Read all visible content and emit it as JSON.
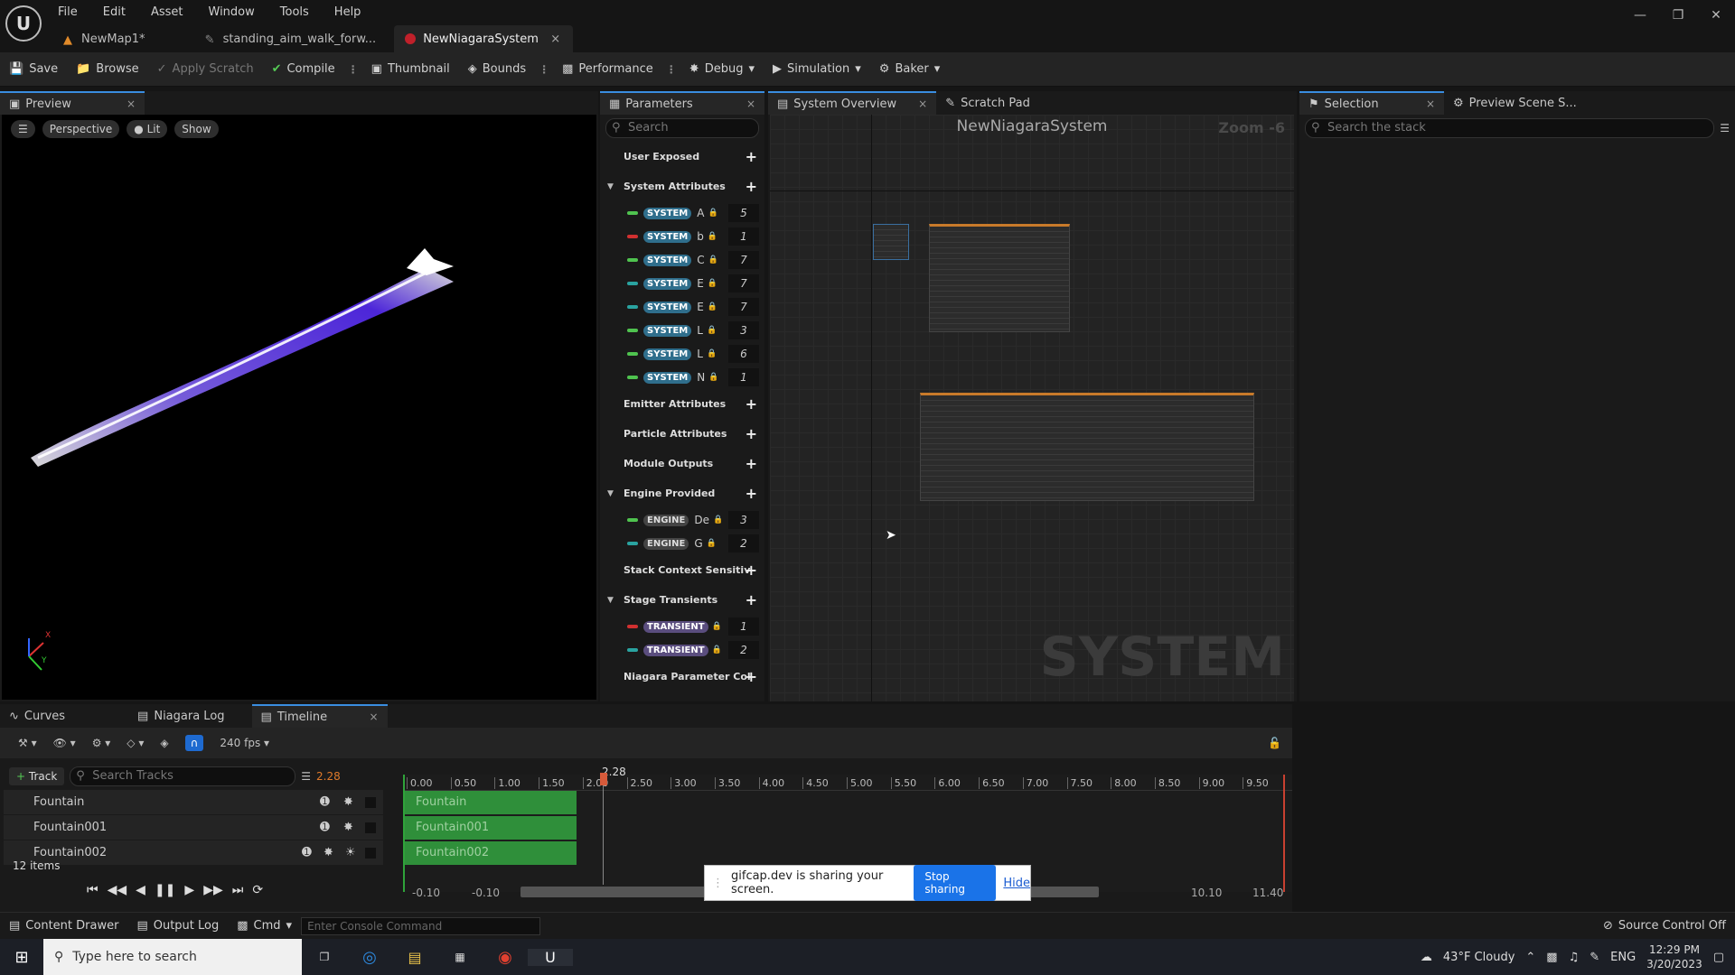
{
  "menu": [
    "File",
    "Edit",
    "Asset",
    "Window",
    "Tools",
    "Help"
  ],
  "doc_tabs": [
    {
      "label": "NewMap1*",
      "icon": "map-icon"
    },
    {
      "label": "standing_aim_walk_forw...",
      "icon": "animation-icon"
    },
    {
      "label": "NewNiagaraSystem",
      "icon": "niagara-system-icon",
      "close": "×"
    }
  ],
  "toolbar": {
    "save": "Save",
    "browse": "Browse",
    "apply_scratch": "Apply Scratch",
    "compile": "Compile",
    "thumbnail": "Thumbnail",
    "bounds": "Bounds",
    "performance": "Performance",
    "debug": "Debug",
    "simulation": "Simulation",
    "baker": "Baker"
  },
  "preview": {
    "tab": "Preview",
    "close": "×",
    "perspective": "Perspective",
    "lit": "Lit",
    "show": "Show",
    "axis_x": "X",
    "axis_y": "Y"
  },
  "parameters": {
    "tab": "Parameters",
    "close": "×",
    "search_placeholder": "Search",
    "cat_user": "User Exposed",
    "cat_system": "System Attributes",
    "system_rows": [
      {
        "tag": "SYSTEM",
        "name": "A",
        "value": "5",
        "color": "#4fc34f"
      },
      {
        "tag": "SYSTEM",
        "name": "b",
        "value": "1",
        "color": "#d03030"
      },
      {
        "tag": "SYSTEM",
        "name": "C",
        "value": "7",
        "color": "#4fc34f"
      },
      {
        "tag": "SYSTEM",
        "name": "E",
        "value": "7",
        "color": "#2aa3a0"
      },
      {
        "tag": "SYSTEM",
        "name": "E",
        "value": "7",
        "color": "#2aa3a0"
      },
      {
        "tag": "SYSTEM",
        "name": "L",
        "value": "3",
        "color": "#4fc34f"
      },
      {
        "tag": "SYSTEM",
        "name": "L",
        "value": "6",
        "color": "#4fc34f"
      },
      {
        "tag": "SYSTEM",
        "name": "N",
        "value": "1",
        "color": "#4fc34f"
      }
    ],
    "cat_emitter": "Emitter Attributes",
    "cat_particle": "Particle Attributes",
    "cat_module": "Module Outputs",
    "cat_engine": "Engine Provided",
    "engine_rows": [
      {
        "tag": "ENGINE",
        "name": "De",
        "value": "3",
        "color": "#4fc34f"
      },
      {
        "tag": "ENGINE",
        "name": "G",
        "value": "2",
        "color": "#2aa3a0"
      }
    ],
    "cat_stack": "Stack Context Sensitiv",
    "cat_stage": "Stage Transients",
    "transient_rows": [
      {
        "tag": "TRANSIENT",
        "value": "1",
        "color": "#d03030"
      },
      {
        "tag": "TRANSIENT",
        "value": "2",
        "color": "#2aa3a0"
      }
    ],
    "cat_niagara": "Niagara Parameter Col"
  },
  "system_overview": {
    "tab": "System Overview",
    "close": "×",
    "scratch_tab": "Scratch Pad",
    "title": "NewNiagaraSystem",
    "zoom": "Zoom -6",
    "watermark": "SYSTEM"
  },
  "selection": {
    "tab": "Selection",
    "close": "×",
    "preview_tab": "Preview Scene S...",
    "search_placeholder": "Search the stack"
  },
  "bottom_tabs": {
    "curves": "Curves",
    "log": "Niagara Log",
    "timeline": "Timeline",
    "close": "×"
  },
  "timeline": {
    "fps": "240 fps",
    "add_track": "Track",
    "search_placeholder": "Search Tracks",
    "current_time": "2.28",
    "playhead_label": "2.28",
    "ticks": [
      "0.00",
      "0.50",
      "1.00",
      "1.50",
      "2.00",
      "2.50",
      "3.00",
      "3.50",
      "4.00",
      "4.50",
      "5.00",
      "5.50",
      "6.00",
      "6.50",
      "7.00",
      "7.50",
      "8.00",
      "8.50",
      "9.00",
      "9.50"
    ],
    "tracks": [
      "Fountain",
      "Fountain001",
      "Fountain002"
    ],
    "item_count": "12 items",
    "range_start_a": "-0.10",
    "range_start_b": "-0.10",
    "range_end_a": "10.10",
    "range_end_b": "11.40"
  },
  "share_popup": {
    "text": "gifcap.dev is sharing your screen.",
    "stop": "Stop sharing",
    "hide": "Hide"
  },
  "status_bar": {
    "content_drawer": "Content Drawer",
    "output_log": "Output Log",
    "cmd": "Cmd",
    "console_placeholder": "Enter Console Command",
    "source_control": "Source Control Off"
  },
  "taskbar": {
    "search_placeholder": "Type here to search",
    "weather": "43°F  Cloudy",
    "lang": "ENG",
    "time": "12:29 PM",
    "date": "3/20/2023"
  }
}
